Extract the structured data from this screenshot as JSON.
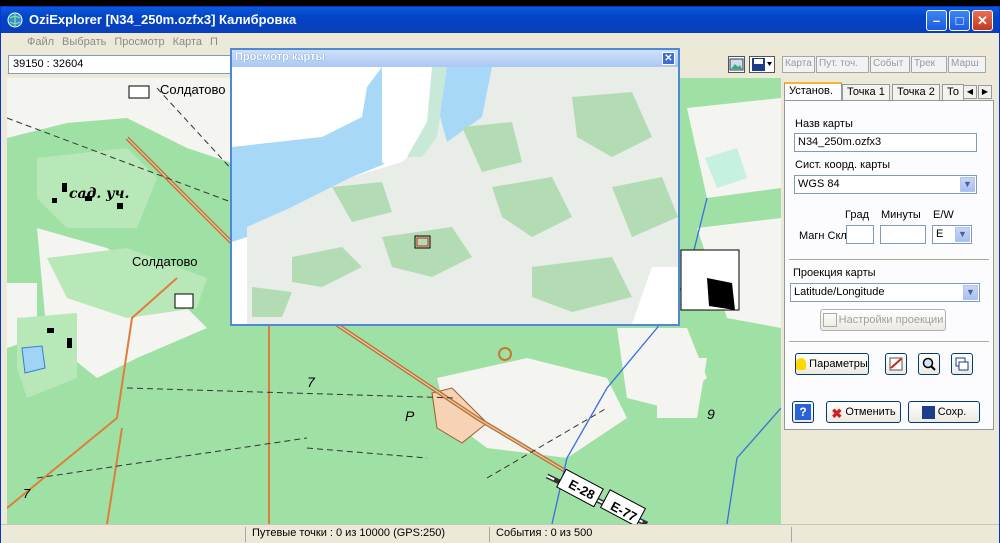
{
  "window": {
    "title": "OziExplorer [N34_250m.ozfx3] Калибровка",
    "minimize_icon": "minimize-icon",
    "maximize_icon": "maximize-icon",
    "close_icon": "close-icon"
  },
  "menu": {
    "items": [
      "Файл",
      "Выбрать",
      "Просмотр",
      "Карта",
      "П"
    ]
  },
  "toolbar": {
    "coordinates": "39150 : 32604",
    "buttons": [
      "Карта",
      "Пут. точ.",
      "Событ",
      "Трек",
      "Марш"
    ]
  },
  "map": {
    "labels": {
      "soldatovo_top": "Солдатово",
      "sad_uch": "сад. уч.",
      "soldatovo_mid": "Солдатово",
      "num_7_left": "7",
      "num_7_center": "7",
      "letter_p": "Р",
      "num_9": "9",
      "road_e28": "Е-28",
      "road_e77": "Е-77"
    }
  },
  "preview": {
    "title": "Просмотр карты"
  },
  "panel": {
    "tabs": [
      "Установ.",
      "Точка 1",
      "Точка 2",
      "То"
    ],
    "map_name_label": "Назв карты",
    "map_name_value": "N34_250m.ozfx3",
    "coord_system_label": "Сист. коорд. карты",
    "coord_system_value": "WGS 84",
    "grad_label": "Град",
    "minutes_label": "Минуты",
    "ew_label": "E/W",
    "magn_label": "Магн Скл",
    "ew_value": "E",
    "projection_label": "Проекция карты",
    "projection_value": "Latitude/Longitude",
    "projection_settings_button": "Настройки проекции",
    "params_button": "Параметры",
    "cancel_button": "Отменить",
    "save_button": "Сохр."
  },
  "status": {
    "waypoints": "Путевые точки : 0 из 10000  (GPS:250)",
    "events": "События : 0 из 500"
  },
  "colors": {
    "forest": "#9fe0a4",
    "open": "#f4f4f0",
    "water": "#9fd4f4",
    "road": "#c8722e",
    "titlebar": "#0343c7"
  }
}
